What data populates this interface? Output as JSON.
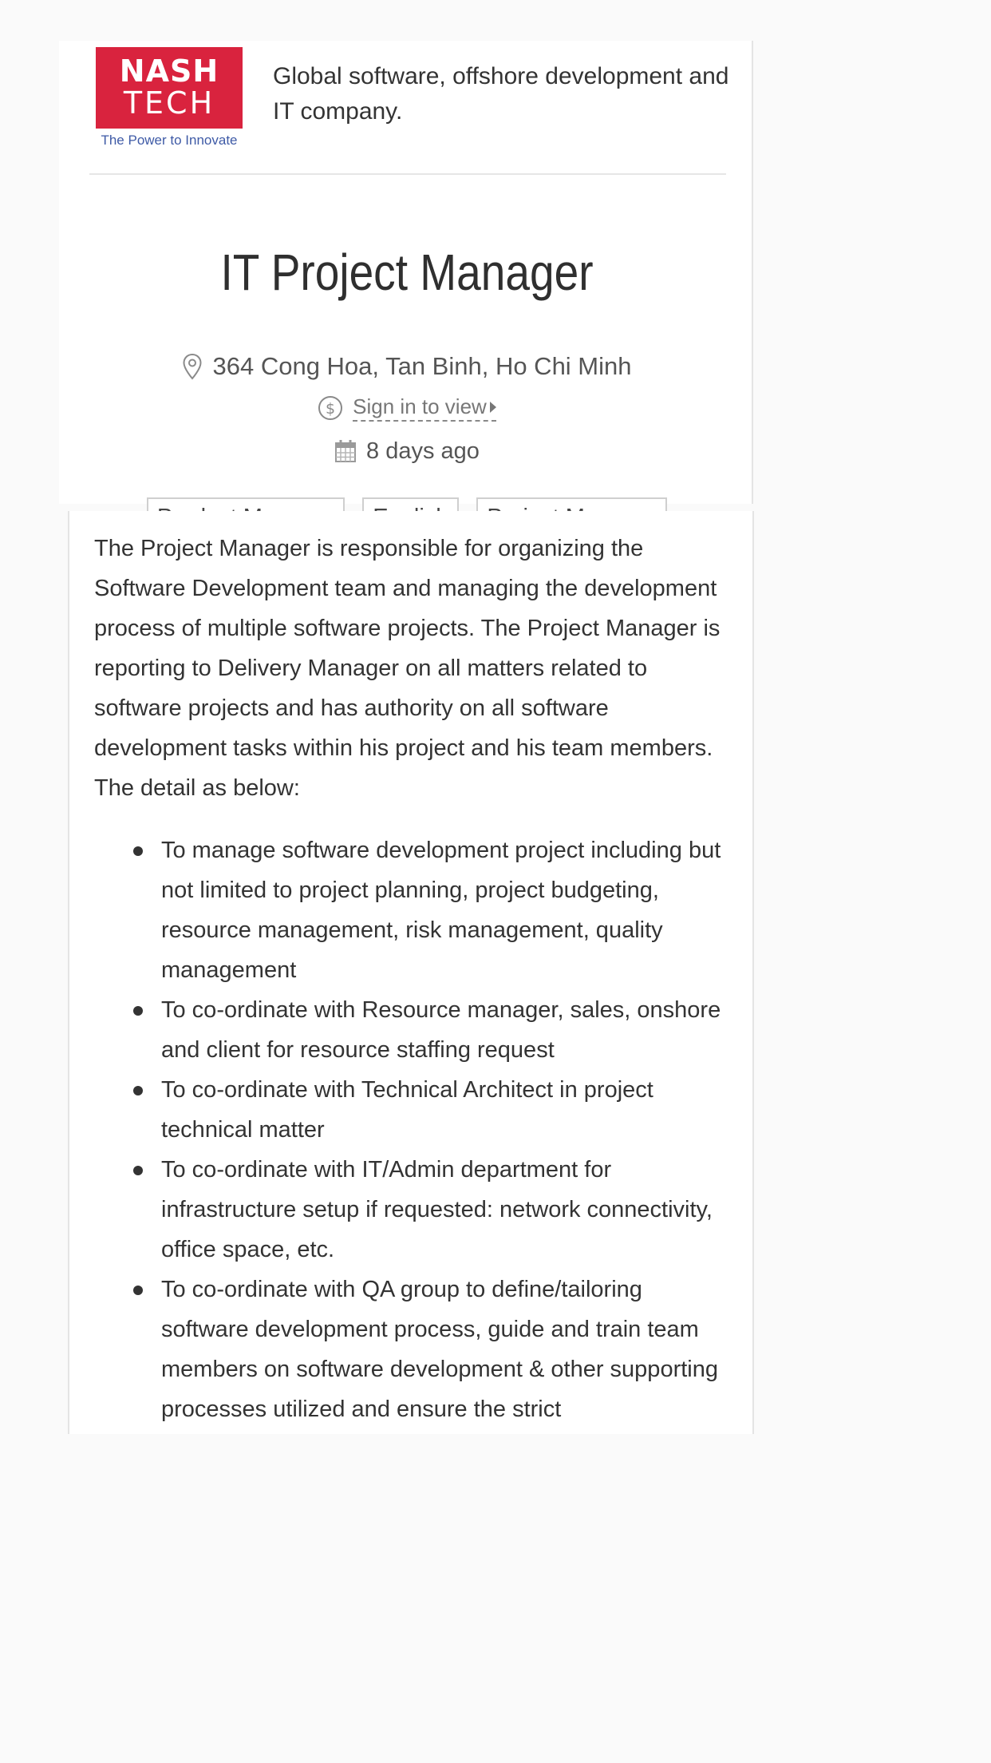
{
  "company": {
    "logo_line1": "NASH",
    "logo_line2": "TECH",
    "logo_tagline": "The Power to Innovate",
    "description": "Global software, offshore development and IT company.",
    "brand_color": "#d9233e"
  },
  "job": {
    "title": "IT Project Manager",
    "location": "364 Cong Hoa, Tan Binh, Ho Chi Minh",
    "salary_link": "Sign in to view",
    "posted": "8 days ago",
    "tags": [
      "Product Manager",
      "English",
      "Project Manager"
    ]
  },
  "icons": {
    "location": "map-pin-icon",
    "salary": "dollar-circle-icon",
    "posted": "calendar-icon"
  },
  "description": {
    "intro": "The Project Manager is responsible for organizing the Software Development team and managing the development process of multiple software projects. The Project Manager is reporting to Delivery Manager on all matters related to software projects and has authority on all software development tasks within his project and his team members. The detail as below:",
    "duties": [
      "To manage software development project including but not limited to project planning, project budgeting, resource management, risk management, quality management",
      "To co-ordinate with Resource manager, sales, onshore and client for resource staffing request",
      "To co-ordinate with Technical Architect in project technical matter",
      "To co-ordinate with IT/Admin department for infrastructure setup if requested: network connectivity, office space, etc.",
      "To co-ordinate with QA group to define/tailoring software development process, guide and train team members on software development & other supporting processes utilized and ensure the strict"
    ]
  }
}
